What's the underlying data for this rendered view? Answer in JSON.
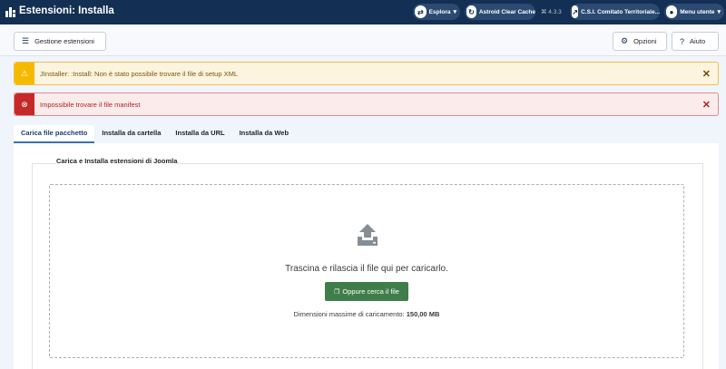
{
  "header": {
    "title": "Estensioni: Installa",
    "explore_label": "Esplora",
    "cache_label": "Astroid Clear Cache",
    "version": "⌘ 4.3.3",
    "site_label": "C.S.I. Comitato Territoriale...",
    "user_menu_label": "Menu utente",
    "icons": [
      "joomla-logo-icon",
      "explore-icon",
      "refresh-icon",
      "external-link-icon",
      "user-icon"
    ]
  },
  "toolbar": {
    "manage_label": "Gestione estensioni",
    "options_label": "Opzioni",
    "help_label": "Aiuto"
  },
  "alerts": [
    {
      "type": "warning",
      "message": "JInstaller: :Install: Non è stato possibile trovare il file di setup XML",
      "color": "#f5b900"
    },
    {
      "type": "error",
      "message": "Impossibile trovare il file manifest",
      "color": "#c52827"
    }
  ],
  "tabs": [
    {
      "label": "Carica file pacchetto",
      "active": true
    },
    {
      "label": "Installa da cartella",
      "active": false
    },
    {
      "label": "Installa da URL",
      "active": false
    },
    {
      "label": "Installa da Web",
      "active": false
    }
  ],
  "upload": {
    "legend": "Carica e Installa estensioni di Joomla",
    "drop_text": "Trascina e rilascia il file qui per caricarlo.",
    "browse_label": "Oppure cerca il file",
    "max_size_label": "Dimensioni massime di caricamento:",
    "max_size_value": "150,00 MB"
  },
  "colors": {
    "header_bg": "#132f53",
    "accent": "#3a6fb8",
    "success": "#3f7e4a"
  }
}
